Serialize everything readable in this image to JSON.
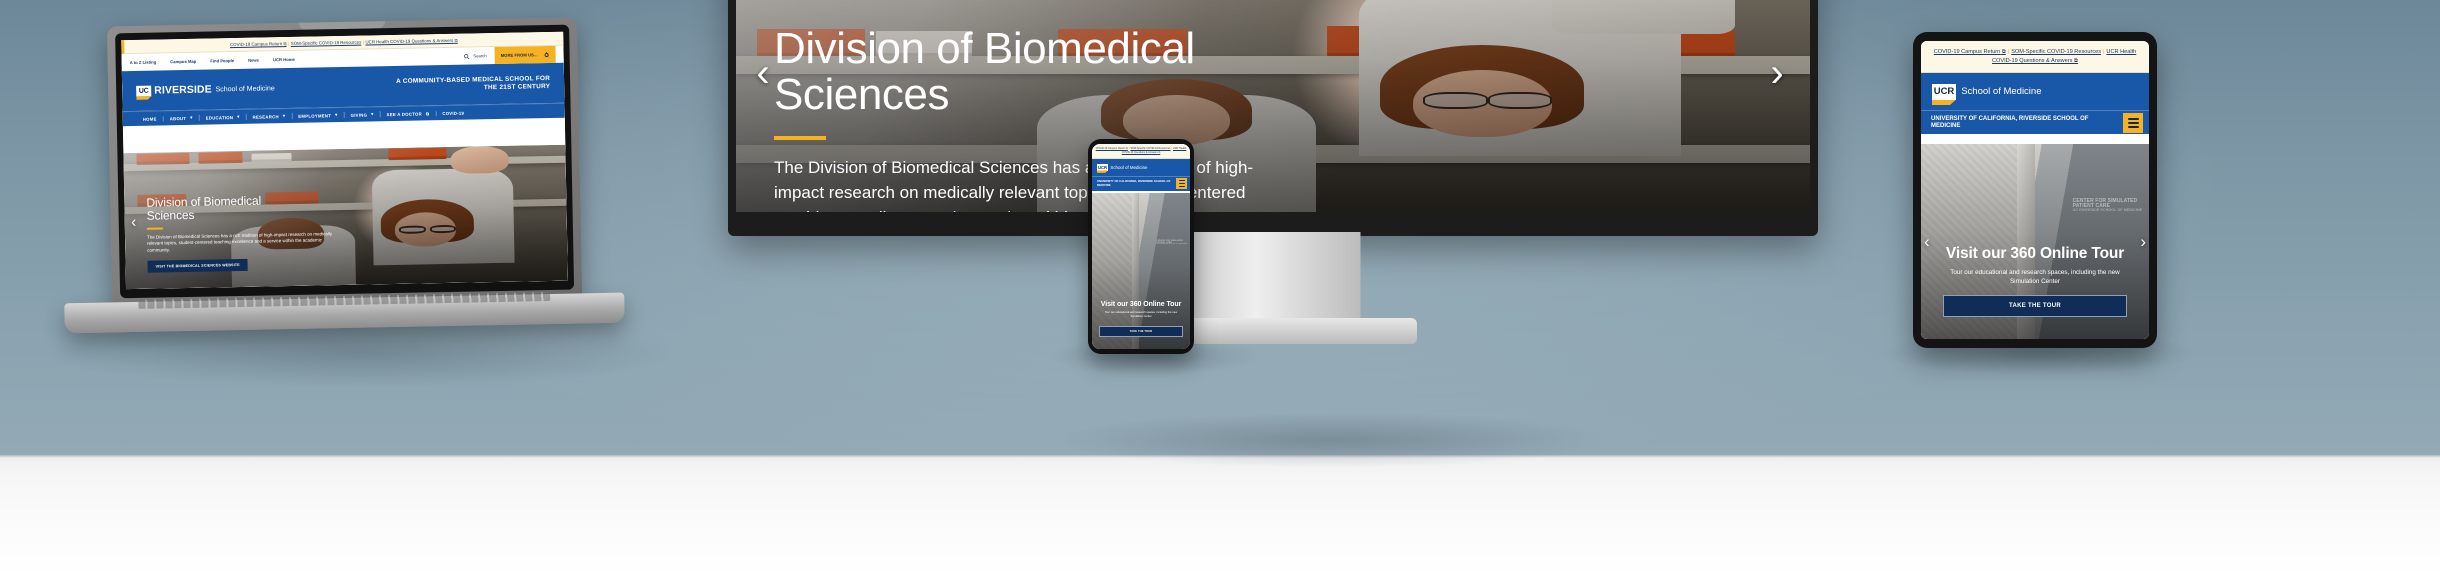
{
  "site": {
    "covid_links": [
      {
        "label": "COVID-19 Campus Return",
        "external": "⧉"
      },
      {
        "label": "SOM-Specific COVID-19 Resources",
        "external": ""
      },
      {
        "label": "UCR Health COVID-19 Questions & Answers",
        "external": "⧉"
      }
    ],
    "utility_links": [
      "A to Z Listing",
      "Campus Map",
      "Find People",
      "News",
      "UCR Home"
    ],
    "search": {
      "label": "Search",
      "icon": "search-icon"
    },
    "more_button": {
      "label": "MORE FROM US...",
      "icon": "gear-icon"
    },
    "brand": {
      "mark": "UC",
      "wordmark": "RIVERSIDE",
      "sub": "School of Medicine"
    },
    "tagline_line1": "A COMMUNITY-BASED MEDICAL SCHOOL FOR",
    "tagline_line2": "THE 21ST CENTURY",
    "main_nav": [
      {
        "label": "HOME",
        "caret": ""
      },
      {
        "label": "ABOUT",
        "caret": "▾"
      },
      {
        "label": "EDUCATION",
        "caret": "▾"
      },
      {
        "label": "RESEARCH",
        "caret": "▾"
      },
      {
        "label": "EMPLOYMENT",
        "caret": "▾"
      },
      {
        "label": "GIVING",
        "caret": "▾"
      },
      {
        "label": "SEE A DOCTOR",
        "caret": "⧉"
      },
      {
        "label": "COVID-19",
        "caret": ""
      }
    ],
    "mobile_brand": {
      "mark": "UCR",
      "sub": "School of Medicine"
    },
    "mobile_title": "UNIVERSITY OF CALIFORNIA, RIVERSIDE SCHOOL OF MEDICINE",
    "mobile_menu_icon": "hamburger-menu-icon"
  },
  "hero_biomedical": {
    "title_line1": "Division of Biomedical",
    "title_line2": "Sciences",
    "body": "The Division of Biomedical Sciences has a rich tradition of high-impact research on medically relevant topics, student-centered teaching excellence and a service within the academic community.",
    "cta": "VISIT THE BIOMEDICAL SCIENCES WEBSITE",
    "prev_arrow": "‹",
    "next_arrow": "›",
    "photo_alt": "researcher-in-laboratory-photo"
  },
  "hero_tour": {
    "title": "Visit our 360 Online Tour",
    "body": "Tour our educational and research spaces, including the new Simulation Center",
    "cta": "TAKE THE TOUR",
    "prev_arrow": "‹",
    "next_arrow": "›",
    "sign_line1": "CENTER FOR SIMULATED",
    "sign_line2": "PATIENT CARE",
    "sign_line3": "UC RIVERSIDE SCHOOL OF MEDICINE",
    "photo_alt": "simulation-center-hallway-photo"
  },
  "colors": {
    "ucr_blue": "#1958a8",
    "ucr_navy": "#13294b",
    "ucr_gold": "#f5b324",
    "covid_bar_bg": "#fdf8e6",
    "cta_navy": "#0f2d57",
    "wall": "#7d97a6"
  },
  "devices": [
    {
      "name": "laptop",
      "shows": "hero_biomedical"
    },
    {
      "name": "monitor",
      "shows": "hero_biomedical"
    },
    {
      "name": "phone",
      "shows": "hero_tour"
    },
    {
      "name": "tablet",
      "shows": "hero_tour"
    }
  ]
}
